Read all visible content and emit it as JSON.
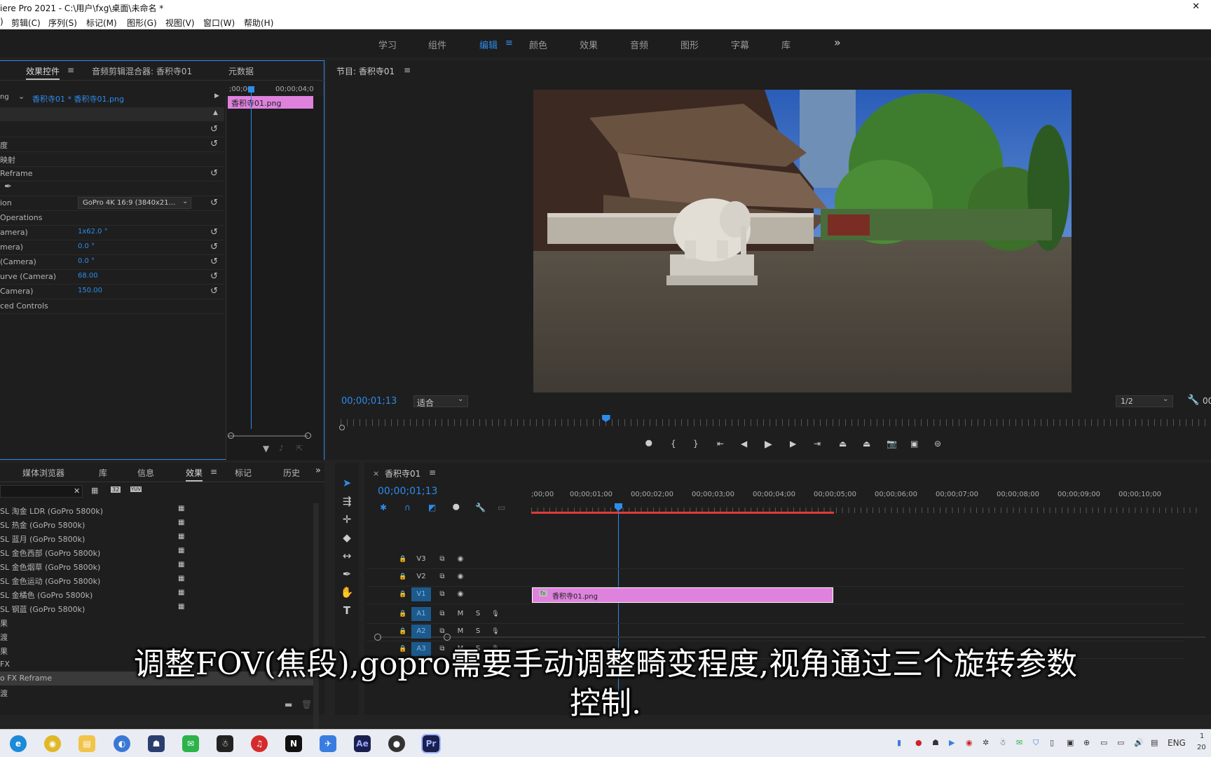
{
  "window": {
    "title": "iere Pro 2021 - C:\\用户\\fxg\\桌面\\未命名 *",
    "close_glyph": "✕"
  },
  "menu": [
    "剪辑(C)",
    "序列(S)",
    "标记(M)",
    "图形(G)",
    "视图(V)",
    "窗口(W)",
    "帮助(H)"
  ],
  "workspaces": {
    "items": [
      "学习",
      "组件",
      "编辑",
      "颜色",
      "效果",
      "音频",
      "图形",
      "字幕",
      "库"
    ],
    "active": "编辑",
    "more": "»"
  },
  "effect_controls": {
    "tabs": [
      "效果控件",
      "音频剪辑混合器: 香积寺01",
      "元数据"
    ],
    "source_prefix": "ng",
    "clip_path": "香积寺01 * 香积寺01.png",
    "ruler_start": ";00;00",
    "ruler_end": "00;00;04;0",
    "clip_label": "香积寺01.png",
    "rows": [
      {
        "label": "",
        "value": "",
        "reset": true
      },
      {
        "label": "度",
        "value": "",
        "reset": true
      },
      {
        "label": "映射",
        "value": "",
        "reset": false
      },
      {
        "label": "Reframe",
        "value": "",
        "reset": true
      },
      {
        "label": "",
        "value": "",
        "reset": false,
        "pen": true
      },
      {
        "label": "ion",
        "value": "GoPro 4K 16:9 (3840x21...",
        "reset": true,
        "dropdown": true
      },
      {
        "label": "Operations",
        "value": "",
        "reset": false
      },
      {
        "label": "amera)",
        "value": "1x62.0 °",
        "reset": true
      },
      {
        "label": "mera)",
        "value": "0.0 °",
        "reset": true
      },
      {
        "label": "(Camera)",
        "value": "0.0 °",
        "reset": true
      },
      {
        "label": "urve (Camera)",
        "value": "68.00",
        "reset": true
      },
      {
        "label": "Camera)",
        "value": "150.00",
        "reset": true
      },
      {
        "label": "ced Controls",
        "value": "",
        "reset": false
      }
    ]
  },
  "program_monitor": {
    "title": "节目: 香积寺01",
    "timecode": "00;00;01;13",
    "fit": "适合",
    "resolution": "1/2",
    "right_timecode": "00",
    "playhead_fraction": 0.3
  },
  "effects_panel": {
    "tabs": [
      "媒体浏览器",
      "库",
      "信息",
      "效果",
      "标记",
      "历史"
    ],
    "active_tab": "效果",
    "items": [
      "SL 淘金 LDR (GoPro 5800k)",
      "SL 热金 (GoPro 5800k)",
      "SL 蓝月 (GoPro 5800k)",
      "SL 金色西部 (GoPro 5800k)",
      "SL 金色烟草 (GoPro 5800k)",
      "SL 金色运动 (GoPro 5800k)",
      "SL 金橘色 (GoPro 5800k)",
      "SL 钢蓝 (GoPro 5800k)",
      "果",
      "渡",
      "果",
      "FX",
      "o FX Reframe",
      "渡"
    ],
    "selected_index": 12,
    "badge_icons": [
      "32",
      "YUV"
    ]
  },
  "timeline": {
    "sequence_name": "香积寺01",
    "timecode": "00;00;01;13",
    "ruler": [
      ";00;00",
      "00;00;01;00",
      "00;00;02;00",
      "00;00;03;00",
      "00;00;04;00",
      "00;00;05;00",
      "00;00;06;00",
      "00;00;07;00",
      "00;00;08;00",
      "00;00;09;00",
      "00;00;10;00"
    ],
    "video_tracks": [
      "V3",
      "V2",
      "V1"
    ],
    "audio_tracks": [
      "A1",
      "A2",
      "A3"
    ],
    "clip_label": "香积寺01.png",
    "clip_fx": "fx",
    "mute": "M",
    "solo": "S"
  },
  "subtitle": {
    "line1": "调整FOV(焦段),gopro需要手动调整畸变程度,视角通过三个旋转参数",
    "line2": "控制."
  },
  "taskbar": {
    "lang": "ENG",
    "clock_top": "1",
    "clock_bottom": "20",
    "apps": [
      "edge",
      "chrome",
      "explorer",
      "browser",
      "cat-app",
      "wechat",
      "qq",
      "netease-music",
      "notion",
      "feishu",
      "after-effects",
      "recorder",
      "premiere"
    ],
    "ae_label": "Ae",
    "pr_label": "Pr"
  }
}
